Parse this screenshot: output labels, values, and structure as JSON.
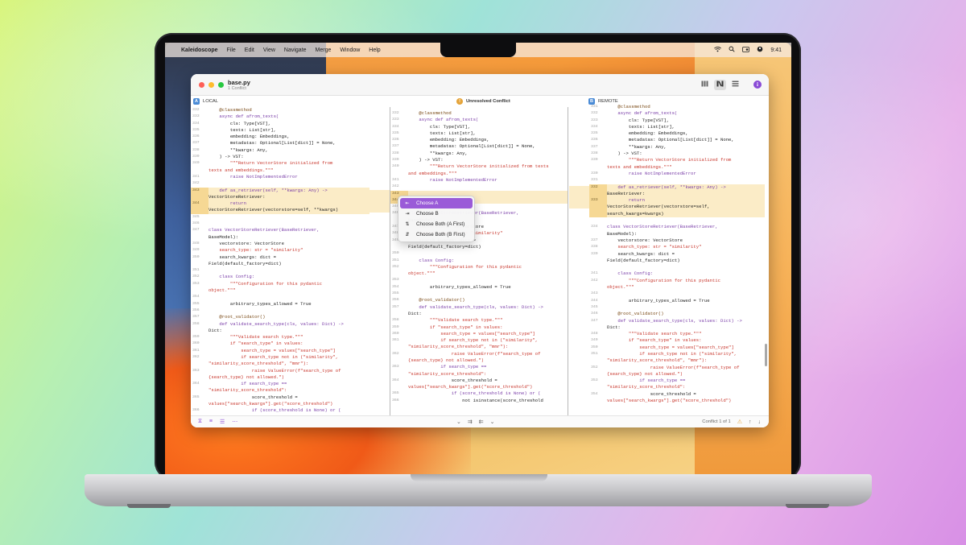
{
  "menubar": {
    "apple": "",
    "app_name": "Kaleidoscope",
    "items": [
      "File",
      "Edit",
      "View",
      "Navigate",
      "Merge",
      "Window",
      "Help"
    ],
    "clock": "9:41"
  },
  "window": {
    "title": "base.py",
    "subtitle": "1 Conflict",
    "view_modes": [
      "columns-view-icon",
      "merge-view-icon",
      "unified-view-icon"
    ],
    "info_label": "i"
  },
  "headers": {
    "local_badge": "A",
    "local_label": "LOCAL",
    "center_label": "Unresolved Conflict",
    "remote_badge": "B",
    "remote_label": "REMOTE"
  },
  "context_menu": {
    "items": [
      {
        "label": "Choose A",
        "icon": "choose-a-icon"
      },
      {
        "label": "Choose B",
        "icon": "choose-b-icon"
      },
      {
        "label": "Choose Both (A First)",
        "icon": "choose-both-a-first-icon"
      },
      {
        "label": "Choose Both (B First)",
        "icon": "choose-both-b-first-icon"
      }
    ]
  },
  "bottombar": {
    "conflict_text": "Conflict 1 of 1"
  },
  "colors": {
    "accent": "#9a5bd8",
    "conflict_highlight": "#fbecc7",
    "badge_blue": "#4a8bd6",
    "warning": "#e5a43a"
  },
  "panes": {
    "local": [
      {
        "n": "332",
        "t": "    @classmethod"
      },
      {
        "n": "333",
        "t": "    async def afrom_texts("
      },
      {
        "n": "334",
        "t": "        cls: Type[VST],"
      },
      {
        "n": "335",
        "t": "        texts: List[str],"
      },
      {
        "n": "336",
        "t": "        embedding: Embeddings,"
      },
      {
        "n": "337",
        "t": "        metadatas: Optional[List[dict]] = None,"
      },
      {
        "n": "338",
        "t": "        **kwargs: Any,"
      },
      {
        "n": "339",
        "t": "    ) -> VST:"
      },
      {
        "n": "340",
        "t": "        \"\"\"Return VectorStore initialized from"
      },
      {
        "n": "",
        "t": "texts and embeddings.\"\"\""
      },
      {
        "n": "341",
        "t": "        raise NotImplementedError"
      },
      {
        "n": "342",
        "t": ""
      },
      {
        "n": "343",
        "t": "    def as_retriever(self, **kwargs: Any) ->",
        "hl": true
      },
      {
        "n": "",
        "t": "VectorStoreRetriever:",
        "hl": true
      },
      {
        "n": "344",
        "t": "        return",
        "hl": true
      },
      {
        "n": "",
        "t": "VectorStoreRetriever(vectorstore=self, **kwargs)",
        "hl": true
      },
      {
        "n": "345",
        "t": ""
      },
      {
        "n": "346",
        "t": ""
      },
      {
        "n": "347",
        "t": "class VectorStoreRetriever(BaseRetriever,"
      },
      {
        "n": "",
        "t": "BaseModel):"
      },
      {
        "n": "348",
        "t": "    vectorstore: VectorStore"
      },
      {
        "n": "349",
        "t": "    search_type: str = \"similarity\""
      },
      {
        "n": "350",
        "t": "    search_kwargs: dict ="
      },
      {
        "n": "",
        "t": "Field(default_factory=dict)"
      },
      {
        "n": "351",
        "t": ""
      },
      {
        "n": "352",
        "t": "    class Config:"
      },
      {
        "n": "353",
        "t": "        \"\"\"Configuration for this pydantic"
      },
      {
        "n": "",
        "t": "object.\"\"\""
      },
      {
        "n": "354",
        "t": ""
      },
      {
        "n": "355",
        "t": "        arbitrary_types_allowed = True"
      },
      {
        "n": "356",
        "t": ""
      },
      {
        "n": "357",
        "t": "    @root_validator()"
      },
      {
        "n": "358",
        "t": "    def validate_search_type(cls, values: Dict) ->"
      },
      {
        "n": "",
        "t": "Dict:"
      },
      {
        "n": "359",
        "t": "        \"\"\"Validate search type.\"\"\""
      },
      {
        "n": "360",
        "t": "        if \"search_type\" in values:"
      },
      {
        "n": "361",
        "t": "            search_type = values[\"search_type\"]"
      },
      {
        "n": "362",
        "t": "            if search_type not in (\"similarity\","
      },
      {
        "n": "",
        "t": "\"similarity_score_threshold\", \"mmr\"):"
      },
      {
        "n": "363",
        "t": "                raise ValueError(f\"search_type of"
      },
      {
        "n": "",
        "t": "{search_type} not allowed.\")"
      },
      {
        "n": "364",
        "t": "            if search_type =="
      },
      {
        "n": "",
        "t": "\"similarity_score_threshold\":"
      },
      {
        "n": "365",
        "t": "                score_threshold ="
      },
      {
        "n": "",
        "t": "values[\"search_kwargs\"].get(\"score_threshold\")"
      },
      {
        "n": "366",
        "t": "                if (score_threshold is None) or ("
      }
    ],
    "center": [
      {
        "n": "332",
        "t": "    @classmethod"
      },
      {
        "n": "333",
        "t": "    async def afrom_texts("
      },
      {
        "n": "334",
        "t": "        cls: Type[VST],"
      },
      {
        "n": "335",
        "t": "        texts: List[str],"
      },
      {
        "n": "336",
        "t": "        embedding: Embeddings,"
      },
      {
        "n": "337",
        "t": "        metadatas: Optional[List[dict]] = None,"
      },
      {
        "n": "338",
        "t": "        **kwargs: Any,"
      },
      {
        "n": "339",
        "t": "    ) -> VST:"
      },
      {
        "n": "340",
        "t": "        \"\"\"Return VectorStore initialized from texts"
      },
      {
        "n": "",
        "t": "and embeddings.\"\"\""
      },
      {
        "n": "341",
        "t": "        raise NotImplementedError"
      },
      {
        "n": "342",
        "t": ""
      },
      {
        "n": "343",
        "t": "",
        "hl": true
      },
      {
        "n": "344",
        "t": "",
        "hl": true
      },
      {
        "n": "345",
        "t": ""
      },
      {
        "n": "346",
        "t": "class VectorStoreRetriever(BaseRetriever,"
      },
      {
        "n": "",
        "t": "BaseModel):"
      },
      {
        "n": "347",
        "t": "    vectorstore: VectorStore"
      },
      {
        "n": "348",
        "t": "    search_type: str = \"similarity\""
      },
      {
        "n": "349",
        "t": "    search_kwargs: dict ="
      },
      {
        "n": "",
        "t": "Field(default_factory=dict)"
      },
      {
        "n": "350",
        "t": ""
      },
      {
        "n": "351",
        "t": "    class Config:"
      },
      {
        "n": "352",
        "t": "        \"\"\"Configuration for this pydantic"
      },
      {
        "n": "",
        "t": "object.\"\"\""
      },
      {
        "n": "353",
        "t": ""
      },
      {
        "n": "354",
        "t": "        arbitrary_types_allowed = True"
      },
      {
        "n": "355",
        "t": ""
      },
      {
        "n": "356",
        "t": "    @root_validator()"
      },
      {
        "n": "357",
        "t": "    def validate_search_type(cls, values: Dict) ->"
      },
      {
        "n": "",
        "t": "Dict:"
      },
      {
        "n": "358",
        "t": "        \"\"\"Validate search type.\"\"\""
      },
      {
        "n": "359",
        "t": "        if \"search_type\" in values:"
      },
      {
        "n": "360",
        "t": "            search_type = values[\"search_type\"]"
      },
      {
        "n": "361",
        "t": "            if search_type not in (\"similarity\","
      },
      {
        "n": "",
        "t": "\"similarity_score_threshold\", \"mmr\"):"
      },
      {
        "n": "362",
        "t": "                raise ValueError(f\"search_type of"
      },
      {
        "n": "",
        "t": "{search_type} not allowed.\")"
      },
      {
        "n": "363",
        "t": "            if search_type =="
      },
      {
        "n": "",
        "t": "\"similarity_score_threshold\":"
      },
      {
        "n": "364",
        "t": "                score_threshold ="
      },
      {
        "n": "",
        "t": "values[\"search_kwargs\"].get(\"score_threshold\")"
      },
      {
        "n": "365",
        "t": "                if (score_threshold is None) or ("
      },
      {
        "n": "366",
        "t": "                    not isinstance(score_threshold"
      }
    ],
    "remote": [
      {
        "n": "331",
        "t": "    @classmethod"
      },
      {
        "n": "332",
        "t": "    async def afrom_texts("
      },
      {
        "n": "333",
        "t": "        cls: Type[VST],"
      },
      {
        "n": "334",
        "t": "        texts: List[str],"
      },
      {
        "n": "335",
        "t": "        embedding: Embeddings,"
      },
      {
        "n": "336",
        "t": "        metadatas: Optional[List[dict]] = None,"
      },
      {
        "n": "337",
        "t": "        **kwargs: Any,"
      },
      {
        "n": "338",
        "t": "    ) -> VST:"
      },
      {
        "n": "339",
        "t": "        \"\"\"Return VectorStore initialized from"
      },
      {
        "n": "",
        "t": "texts and embeddings.\"\"\""
      },
      {
        "n": "330",
        "t": "        raise NotImplementedError"
      },
      {
        "n": "331",
        "t": ""
      },
      {
        "n": "332",
        "t": "    def as_retriever(self, **kwargs: Any) ->",
        "hl": true
      },
      {
        "n": "",
        "t": "BaseRetriever:",
        "hl": true
      },
      {
        "n": "333",
        "t": "        return",
        "hl": true
      },
      {
        "n": "",
        "t": "VectorStoreRetriever(vectorstore=self,",
        "hl": true
      },
      {
        "n": "",
        "t": "search_kwargs=kwargs)",
        "hl": true
      },
      {
        "n": "",
        "t": ""
      },
      {
        "n": "334",
        "t": "class VectorStoreRetriever(BaseRetriever,"
      },
      {
        "n": "",
        "t": "BaseModel):"
      },
      {
        "n": "337",
        "t": "    vectorstore: VectorStore"
      },
      {
        "n": "338",
        "t": "    search_type: str = \"similarity\""
      },
      {
        "n": "339",
        "t": "    search_kwargs: dict ="
      },
      {
        "n": "",
        "t": "Field(default_factory=dict)"
      },
      {
        "n": "",
        "t": ""
      },
      {
        "n": "341",
        "t": "    class Config:"
      },
      {
        "n": "342",
        "t": "        \"\"\"Configuration for this pydantic"
      },
      {
        "n": "",
        "t": "object.\"\"\""
      },
      {
        "n": "343",
        "t": ""
      },
      {
        "n": "344",
        "t": "        arbitrary_types_allowed = True"
      },
      {
        "n": "345",
        "t": ""
      },
      {
        "n": "346",
        "t": "    @root_validator()"
      },
      {
        "n": "347",
        "t": "    def validate_search_type(cls, values: Dict) ->"
      },
      {
        "n": "",
        "t": "Dict:"
      },
      {
        "n": "348",
        "t": "        \"\"\"Validate search type.\"\"\""
      },
      {
        "n": "349",
        "t": "        if \"search_type\" in values:"
      },
      {
        "n": "350",
        "t": "            search_type = values[\"search_type\"]"
      },
      {
        "n": "351",
        "t": "            if search_type not in (\"similarity\","
      },
      {
        "n": "",
        "t": "\"similarity_score_threshold\", \"mmr\"):"
      },
      {
        "n": "352",
        "t": "                raise ValueError(f\"search_type of"
      },
      {
        "n": "",
        "t": "{search_type} not allowed.\")"
      },
      {
        "n": "353",
        "t": "            if search_type =="
      },
      {
        "n": "",
        "t": "\"similarity_score_threshold\":"
      },
      {
        "n": "354",
        "t": "                score_threshold ="
      },
      {
        "n": "",
        "t": "values[\"search_kwargs\"].get(\"score_threshold\")"
      }
    ]
  }
}
